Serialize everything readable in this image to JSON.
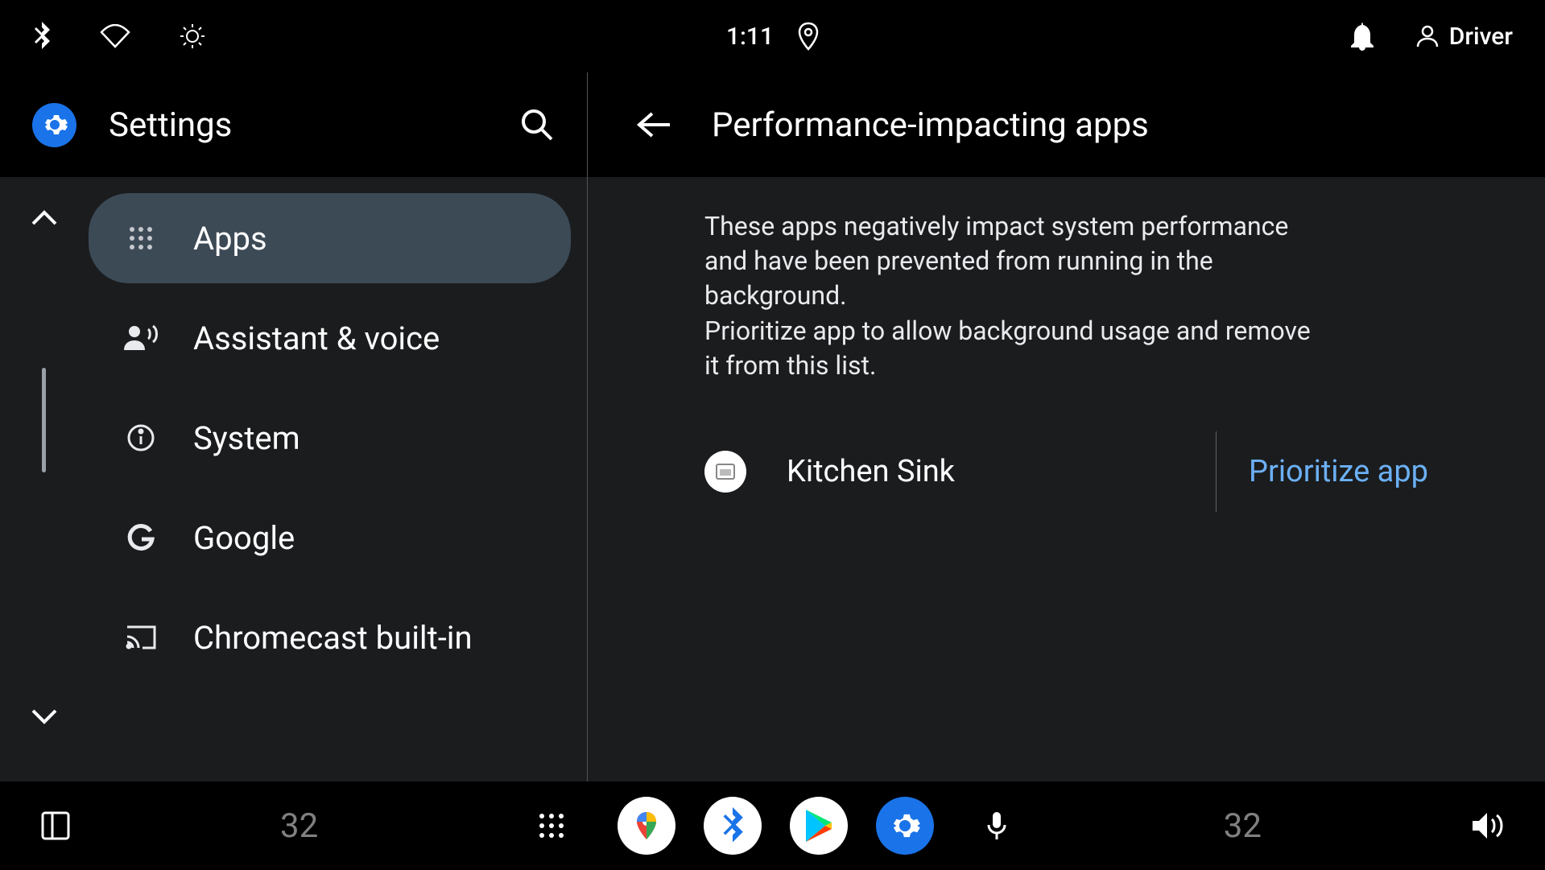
{
  "status": {
    "time": "1:11",
    "user_label": "Driver"
  },
  "sidebar": {
    "title": "Settings",
    "items": [
      {
        "label": "Apps",
        "selected": true
      },
      {
        "label": "Assistant & voice",
        "selected": false
      },
      {
        "label": "System",
        "selected": false
      },
      {
        "label": "Google",
        "selected": false
      },
      {
        "label": "Chromecast built-in",
        "selected": false
      }
    ]
  },
  "content": {
    "title": "Performance-impacting apps",
    "description_line1": "These apps negatively impact system performance and have been prevented from running in the background.",
    "description_line2": "Prioritize app to allow background usage and remove it from this list.",
    "apps": [
      {
        "name": "Kitchen Sink",
        "action": "Prioritize app"
      }
    ]
  },
  "bottom": {
    "temp_left": "32",
    "temp_right": "32"
  }
}
